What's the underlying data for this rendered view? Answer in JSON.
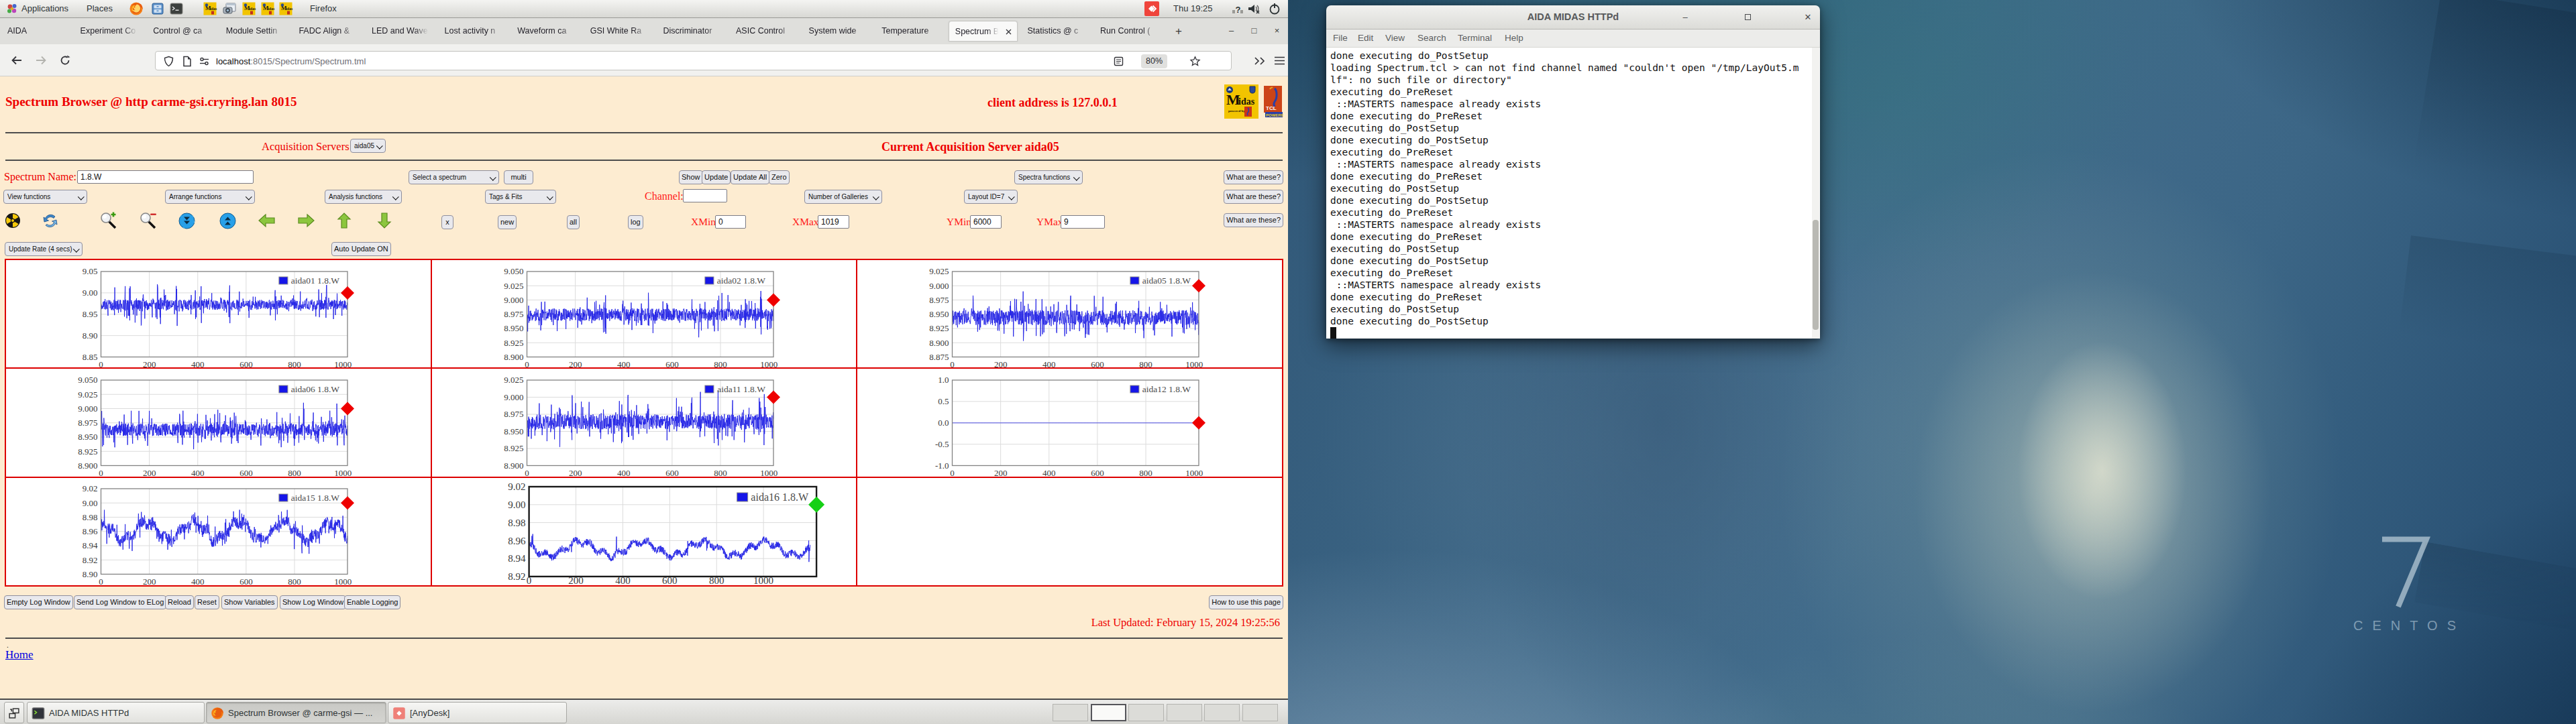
{
  "top_bar": {
    "applications_label": "Applications",
    "places_label": "Places",
    "focused_app_label": "Firefox",
    "clock": "Thu 19:25",
    "launcher_icons": [
      "firefox-icon",
      "file-manager-icon",
      "terminal-icon",
      "midas-icon",
      "screenshot-icon",
      "midas-icon",
      "midas-icon",
      "midas-icon"
    ],
    "tray_icons": [
      "anydesk-icon",
      "network-unknown-icon",
      "volume-muted-icon",
      "power-icon"
    ]
  },
  "firefox": {
    "tabs": [
      {
        "label": "AIDA"
      },
      {
        "label": "Experiment Co"
      },
      {
        "label": "Control @ ca"
      },
      {
        "label": "Module Settin"
      },
      {
        "label": "FADC Align &"
      },
      {
        "label": "LED and Wave"
      },
      {
        "label": "Lost activity n"
      },
      {
        "label": "Waveform ca"
      },
      {
        "label": "GSI White Ra"
      },
      {
        "label": "Discriminator"
      },
      {
        "label": "ASIC Control"
      },
      {
        "label": "System wide"
      },
      {
        "label": "Temperature"
      },
      {
        "label": "Spectrum B",
        "active": true,
        "close": "×"
      },
      {
        "label": "Statistics @ c"
      },
      {
        "label": "Run Control ("
      }
    ],
    "new_tab_button": "+",
    "window_controls": {
      "minimize": "–",
      "maximize": "□",
      "close": "×"
    },
    "url": {
      "host": "localhost",
      "rest": ":8015/Spectrum/Spectrum.tml"
    },
    "zoom_level": "80%"
  },
  "page": {
    "title": "Spectrum Browser @ http carme-gsi.cryring.lan 8015",
    "client_address": "client address is 127.0.0.1",
    "acquisition_servers_label": "Acquisition Servers",
    "acquisition_server_select": "aida05",
    "current_server_text": "Current Acquisition Server aida05",
    "spectrum_name_label": "Spectrum Name:",
    "spectrum_name_value": "1.8.W",
    "select_spectrum": "Select a spectrum",
    "multi_button": "multi",
    "show_button": "Show",
    "update_button": "Update",
    "update_all_button": "Update All",
    "zero_button": "Zero",
    "spectra_functions_select": "Spectra functions",
    "what_are_these_button": "What are these?",
    "view_functions_select": "View functions",
    "arrange_functions_select": "Arrange functions",
    "analysis_functions_select": "Analysis functions",
    "tags_fits_select": "Tags & Fits",
    "channel_label": "Channel:",
    "channel_value": "",
    "number_of_galleries_select": "Number of Galleries",
    "layout_id_select": "Layout ID=7",
    "x_button": "x",
    "new_button": "new",
    "all_button": "all",
    "log_button": "log",
    "xmin_label": "XMin",
    "xmin_value": "0",
    "xmax_label": "XMax",
    "xmax_value": "1019",
    "ymin_label": "YMin",
    "ymin_value": "6000",
    "ymax_label": "YMax",
    "ymax_value": "9",
    "update_rate_select": "Update Rate (4 secs)",
    "auto_update_button": "Auto Update ON",
    "icon_toolbar": [
      "radioactive-icon",
      "refresh-icon",
      "zoom-in-icon",
      "zoom-out-icon",
      "scroll-down-icon",
      "scroll-up-icon",
      "arrow-left-icon",
      "arrow-right-icon",
      "arrow-up-icon",
      "arrow-down-icon"
    ],
    "log_buttons": [
      "Empty Log Window",
      "Send Log Window to ELog",
      "Reload",
      "Reset",
      "Show Variables",
      "Show Log Window",
      "Enable Logging"
    ],
    "how_to_button": "How to use this page",
    "last_updated": "Last Updated: February 15, 2024 19:25:56",
    "footer_dot": ".",
    "home_link": "Home"
  },
  "taskbar": {
    "show_desktop_icon": "show-desktop-icon",
    "windows": [
      {
        "label": "AIDA MIDAS HTTPd",
        "icon": "terminal-icon",
        "active": false
      },
      {
        "label": "Spectrum Browser @ carme-gsi — ...",
        "icon": "firefox-icon",
        "active": true
      },
      {
        "label": "[AnyDesk]",
        "icon": "anydesk-icon",
        "active": false
      }
    ],
    "workspaces": 6,
    "active_workspace": 2
  },
  "terminal": {
    "title": "AIDA MIDAS HTTPd",
    "menus": [
      "File",
      "Edit",
      "View",
      "Search",
      "Terminal",
      "Help"
    ],
    "lines": [
      "done executing do_PostSetup",
      "loading Spectrum.tcl > can not find channel named \"couldn't open \"/tmp/LayOut5.m",
      "lf\": no such file or directory\"",
      "executing do_PreReset",
      " ::MASTERTS namespace already exists",
      "done executing do_PreReset",
      "executing do_PostSetup",
      "done executing do_PostSetup",
      "executing do_PreReset",
      " ::MASTERTS namespace already exists",
      "done executing do_PreReset",
      "executing do_PostSetup",
      "done executing do_PostSetup",
      "executing do_PreReset",
      " ::MASTERTS namespace already exists",
      "done executing do_PreReset",
      "executing do_PostSetup",
      "done executing do_PostSetup",
      "executing do_PreReset",
      " ::MASTERTS namespace already exists",
      "done executing do_PreReset",
      "executing do_PostSetup",
      "done executing do_PostSetup"
    ]
  },
  "wallpaper": {
    "watermark_number": "7",
    "watermark_word": "CENTOS"
  },
  "chart_data": [
    {
      "type": "line",
      "id": "aida01",
      "legend": "aida01 1.8.W",
      "row": 0,
      "col": 0,
      "ylim": [
        8.85,
        9.05
      ],
      "yticks": [
        "9.05",
        "9.00",
        "8.95",
        "8.90",
        "8.85"
      ],
      "xticks": [
        "0",
        "200",
        "400",
        "600",
        "800",
        "1000"
      ],
      "x_axis_max": 1019,
      "n_points": 1020,
      "baseline": 8.972,
      "noise": 0.012,
      "spike_prob": 0.02,
      "spike_amp": 0.045,
      "seed": 11,
      "marker": {
        "color": "#ee0000",
        "value": 9.0
      }
    },
    {
      "type": "line",
      "id": "aida02",
      "legend": "aida02 1.8.W",
      "row": 0,
      "col": 1,
      "ylim": [
        8.9,
        9.05
      ],
      "yticks": [
        "9.050",
        "9.025",
        "9.000",
        "8.975",
        "8.950",
        "8.925",
        "8.900"
      ],
      "xticks": [
        "0",
        "200",
        "400",
        "600",
        "800",
        "1000"
      ],
      "x_axis_max": 1019,
      "n_points": 1020,
      "baseline": 8.974,
      "noise": 0.011,
      "spike_prob": 0.015,
      "spike_amp": 0.035,
      "seed": 22,
      "marker": {
        "color": "#ee0000",
        "value": 9.0
      }
    },
    {
      "type": "line",
      "id": "aida05",
      "legend": "aida05 1.8.W",
      "row": 0,
      "col": 2,
      "ylim": [
        8.875,
        9.025
      ],
      "yticks": [
        "9.025",
        "9.000",
        "8.975",
        "8.950",
        "8.925",
        "8.900",
        "8.875"
      ],
      "xticks": [
        "0",
        "200",
        "400",
        "600",
        "800",
        "1000"
      ],
      "x_axis_max": 1019,
      "n_points": 1020,
      "baseline": 8.944,
      "noise": 0.013,
      "spike_prob": 0.01,
      "spike_amp": 0.04,
      "seed": 33,
      "marker": {
        "color": "#ee0000",
        "value": 9.0
      }
    },
    {
      "type": "line",
      "id": "aida06",
      "legend": "aida06 1.8.W",
      "row": 1,
      "col": 0,
      "ylim": [
        8.9,
        9.05
      ],
      "yticks": [
        "9.050",
        "9.025",
        "9.000",
        "8.975",
        "8.950",
        "8.925",
        "8.900"
      ],
      "xticks": [
        "0",
        "200",
        "400",
        "600",
        "800",
        "1000"
      ],
      "x_axis_max": 1019,
      "n_points": 1020,
      "baseline": 8.963,
      "noise": 0.011,
      "spike_prob": 0.016,
      "spike_amp": 0.035,
      "seed": 44,
      "marker": {
        "color": "#ee0000",
        "value": 9.0
      }
    },
    {
      "type": "line",
      "id": "aida11",
      "legend": "aida11 1.8.W",
      "row": 1,
      "col": 1,
      "ylim": [
        8.9,
        9.025
      ],
      "yticks": [
        "9.025",
        "9.000",
        "8.975",
        "8.950",
        "8.925",
        "8.900"
      ],
      "xticks": [
        "0",
        "200",
        "400",
        "600",
        "800",
        "1000"
      ],
      "x_axis_max": 1019,
      "n_points": 1020,
      "baseline": 8.964,
      "noise": 0.011,
      "spike_prob": 0.012,
      "spike_amp": 0.035,
      "seed": 55,
      "marker": {
        "color": "#ee0000",
        "value": 9.0
      }
    },
    {
      "type": "line",
      "id": "aida12",
      "legend": "aida12 1.8.W",
      "row": 1,
      "col": 2,
      "ylim": [
        -1.0,
        1.0
      ],
      "yticks": [
        "1.0",
        "0.5",
        "0.0",
        "-0.5",
        "-1.0"
      ],
      "xticks": [
        "0",
        "200",
        "400",
        "600",
        "800",
        "1000"
      ],
      "x_axis_max": 1019,
      "n_points": 1020,
      "baseline": 0.0,
      "noise": 0.0,
      "spike_prob": 0.0,
      "spike_amp": 0.0,
      "seed": 66,
      "marker": {
        "color": "#ee0000",
        "value": 0.0
      }
    },
    {
      "type": "line",
      "id": "aida15",
      "legend": "aida15 1.8.W",
      "row": 2,
      "col": 0,
      "ylim": [
        8.9,
        9.02
      ],
      "yticks": [
        "9.02",
        "9.00",
        "8.98",
        "8.96",
        "8.94",
        "8.92",
        "8.90"
      ],
      "xticks": [
        "0",
        "200",
        "400",
        "600",
        "800",
        "1000"
      ],
      "x_axis_max": 1019,
      "n_points": 1020,
      "baseline": 8.9605,
      "noise": 0.0075,
      "spike_prob": 0.004,
      "spike_amp": 0.025,
      "seed": 77,
      "wave": [
        {
          "amp": 0.0125,
          "period": 190,
          "phase": 1.6
        },
        {
          "amp": 0.004,
          "period": 55,
          "phase": 2.0
        }
      ],
      "marker": {
        "color": "#ee0000",
        "value": 9.0
      }
    },
    {
      "type": "line",
      "id": "aida16",
      "legend": "aida16 1.8.W",
      "row": 2,
      "col": 1,
      "big": true,
      "ylim": [
        8.92,
        9.02
      ],
      "yticks": [
        "9.02",
        "9.00",
        "8.98",
        "8.96",
        "8.94",
        "8.92"
      ],
      "xticks": [
        "0",
        "200",
        "400",
        "600",
        "800",
        "1000"
      ],
      "x_axis_max": 1226,
      "n_points": 1200,
      "baseline": 8.951,
      "noise": 0.0038,
      "spike_prob": 0.003,
      "spike_amp": 0.016,
      "seed": 88,
      "excursion": false,
      "wave": [
        {
          "amp": 0.0075,
          "period": 262,
          "phase": 2.6
        },
        {
          "amp": 0.0028,
          "period": 62,
          "phase": 0.6
        }
      ],
      "marker": {
        "color": "#16d016",
        "value": 9.0
      }
    }
  ]
}
